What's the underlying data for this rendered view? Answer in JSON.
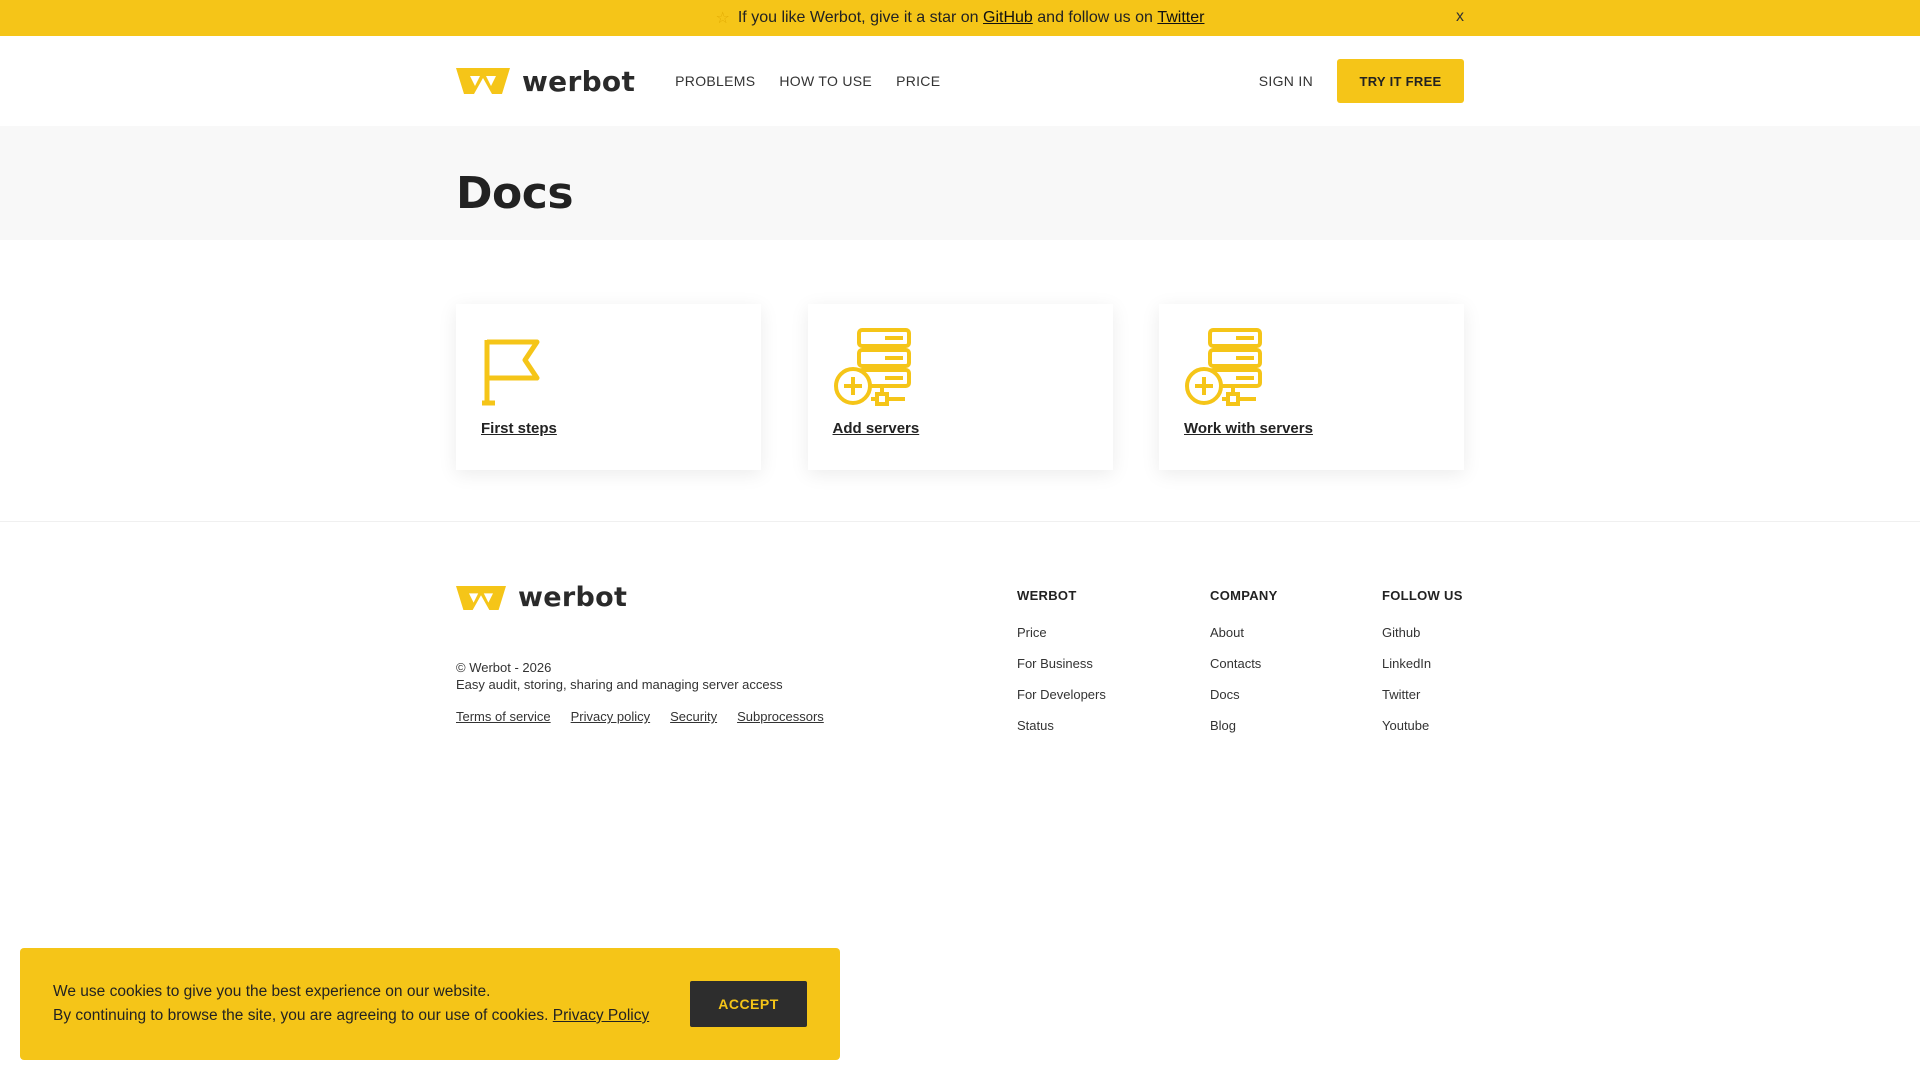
{
  "announcement": {
    "star_icon": "star-icon",
    "text_before": "If you like Werbot, give it a star on",
    "github_link": "GitHub",
    "text_middle": "and follow us on",
    "twitter_link": "Twitter",
    "close_label": "x"
  },
  "header": {
    "logo_text": "werbot",
    "nav": [
      {
        "label": "PROBLEMS"
      },
      {
        "label": "HOW TO USE"
      },
      {
        "label": "PRICE"
      }
    ],
    "sign_in": "SIGN IN",
    "try_free": "TRY IT FREE"
  },
  "page": {
    "title": "Docs"
  },
  "cards": [
    {
      "label": "First steps",
      "icon": "flag-icon"
    },
    {
      "label": "Add servers",
      "icon": "add-server-icon"
    },
    {
      "label": "Work with servers",
      "icon": "server-icon"
    }
  ],
  "footer": {
    "logo_text": "werbot",
    "copyright": "© Werbot - 2026",
    "tagline": "Easy audit, storing, sharing and managing server access",
    "legal": [
      {
        "label": "Terms of service"
      },
      {
        "label": "Privacy policy"
      },
      {
        "label": "Security"
      },
      {
        "label": "Subprocessors"
      }
    ],
    "columns": [
      {
        "title": "WERBOT",
        "links": [
          "Price",
          "For Business",
          "For Developers",
          "Status"
        ]
      },
      {
        "title": "COMPANY",
        "links": [
          "About",
          "Contacts",
          "Docs",
          "Blog"
        ]
      },
      {
        "title": "FOLLOW US",
        "links": [
          "Github",
          "LinkedIn",
          "Twitter",
          "Youtube"
        ]
      }
    ]
  },
  "cookie": {
    "line1": "We use cookies to give you the best experience on our website.",
    "line2": "By continuing to browse the site, you are agreeing to our use of cookies.",
    "policy_link": "Privacy Policy",
    "accept": "ACCEPT"
  },
  "colors": {
    "brand_yellow": "#f5c518",
    "dark": "#2d2d2d"
  }
}
